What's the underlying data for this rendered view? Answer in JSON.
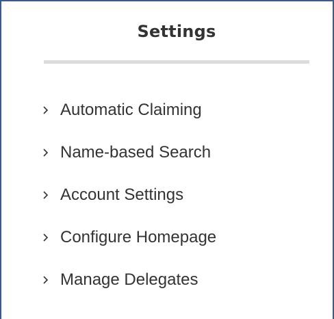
{
  "settings_panel": {
    "title": "Settings",
    "items": [
      {
        "label": "Automatic Claiming",
        "icon": "chevron-right-icon"
      },
      {
        "label": "Name-based Search",
        "icon": "chevron-right-icon"
      },
      {
        "label": "Account Settings",
        "icon": "chevron-right-icon"
      },
      {
        "label": "Configure Homepage",
        "icon": "chevron-right-icon"
      },
      {
        "label": "Manage Delegates",
        "icon": "chevron-right-icon"
      }
    ]
  },
  "colors": {
    "frame_border": "#3a5a8c",
    "text": "#333333",
    "divider": "#dcdcdc",
    "background": "#ffffff"
  }
}
